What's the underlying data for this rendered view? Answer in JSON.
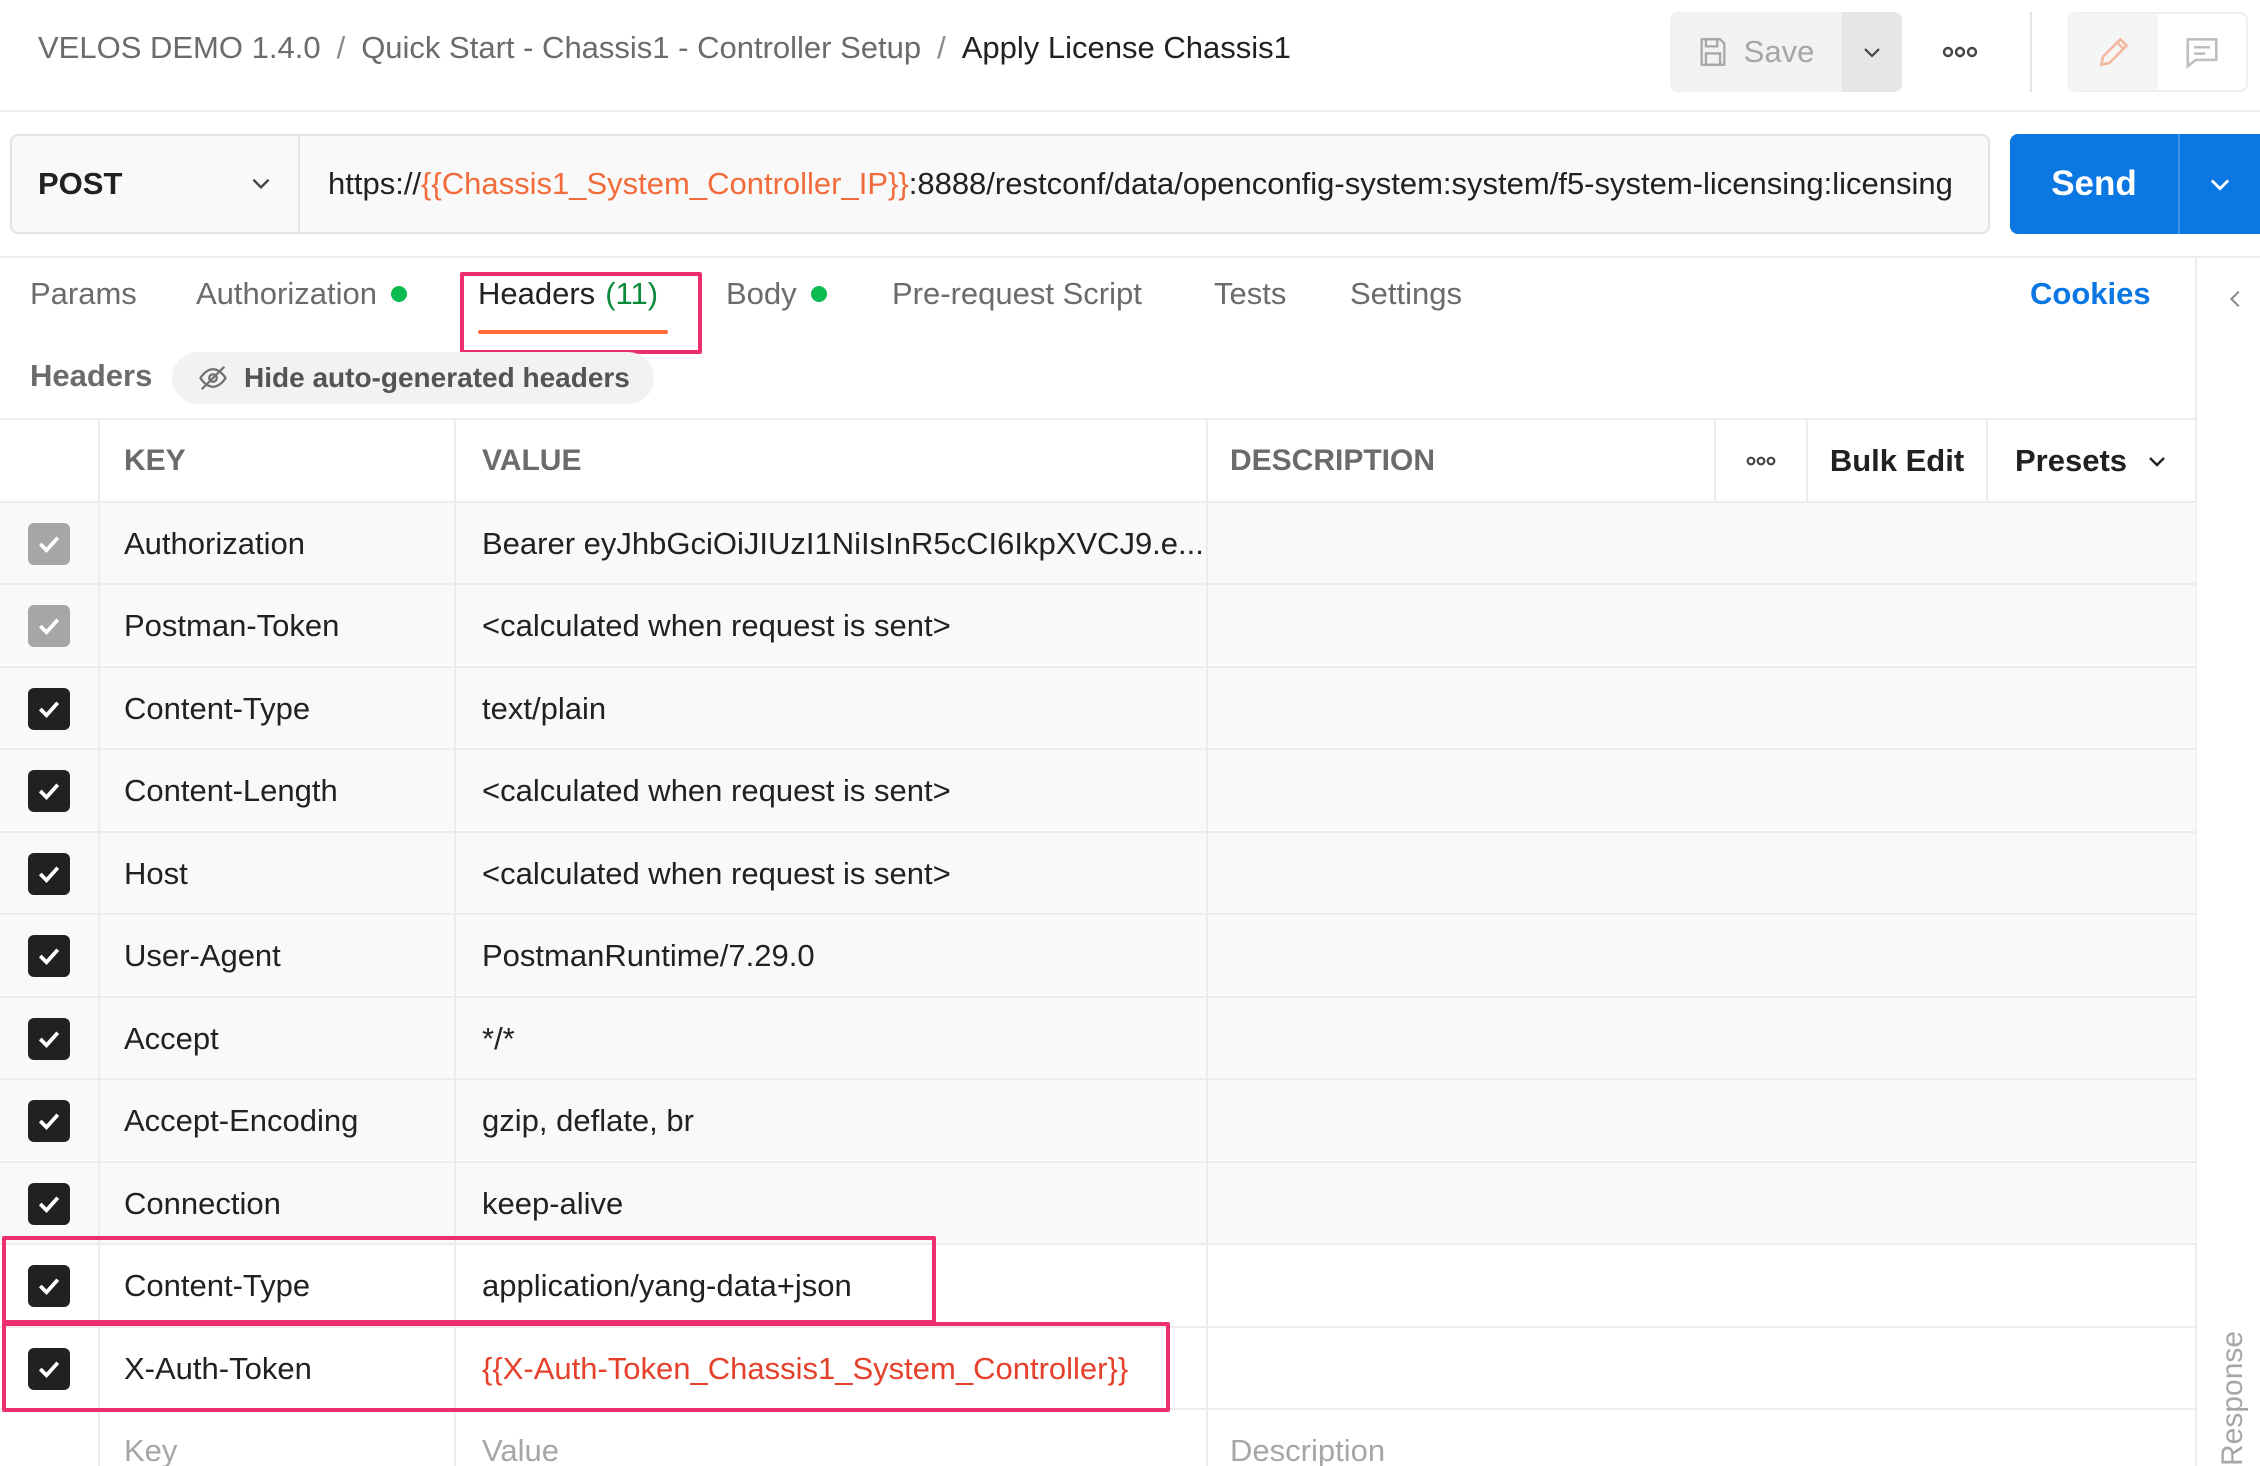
{
  "breadcrumb": {
    "collection": "VELOS DEMO 1.4.0",
    "folder": "Quick Start - Chassis1 - Controller Setup",
    "request": "Apply License Chassis1",
    "separator": "/"
  },
  "toolbar": {
    "save_label": "Save"
  },
  "request": {
    "method": "POST",
    "url_prefix": "https://",
    "url_variable": "{{Chassis1_System_Controller_IP}}",
    "url_suffix": ":8888/restconf/data/openconfig-system:system/f5-system-licensing:licensing"
  },
  "send_label": "Send",
  "tabs": {
    "params": "Params",
    "authorization": "Authorization",
    "headers": "Headers",
    "headers_count": "(11)",
    "body": "Body",
    "prerequest": "Pre-request Script",
    "tests": "Tests",
    "settings": "Settings",
    "cookies": "Cookies"
  },
  "headers_section": {
    "label": "Headers",
    "hide_auto_label": "Hide auto-generated headers"
  },
  "table": {
    "columns": {
      "key": "KEY",
      "value": "VALUE",
      "description": "DESCRIPTION"
    },
    "bulk_edit": "Bulk Edit",
    "presets": "Presets",
    "rows": [
      {
        "key": "Authorization",
        "value": "Bearer eyJhbGciOiJIUzI1NiIsInR5cCI6IkpXVCJ9.e...",
        "description": ""
      },
      {
        "key": "Postman-Token",
        "value": "<calculated when request is sent>",
        "description": ""
      },
      {
        "key": "Content-Type",
        "value": "text/plain",
        "description": ""
      },
      {
        "key": "Content-Length",
        "value": "<calculated when request is sent>",
        "description": ""
      },
      {
        "key": "Host",
        "value": "<calculated when request is sent>",
        "description": ""
      },
      {
        "key": "User-Agent",
        "value": "PostmanRuntime/7.29.0",
        "description": ""
      },
      {
        "key": "Accept",
        "value": "*/*",
        "description": ""
      },
      {
        "key": "Accept-Encoding",
        "value": "gzip, deflate, br",
        "description": ""
      },
      {
        "key": "Connection",
        "value": "keep-alive",
        "description": ""
      },
      {
        "key": "Content-Type",
        "value": "application/yang-data+json",
        "description": ""
      },
      {
        "key": "X-Auth-Token",
        "value": "{{X-Auth-Token_Chassis1_System_Controller}}",
        "description": ""
      }
    ],
    "placeholder": {
      "key": "Key",
      "value": "Value",
      "description": "Description"
    }
  },
  "response_label": "Response",
  "colors": {
    "accent": "#ff6c37",
    "send": "#0b77e3",
    "highlight": "#ee2f6d",
    "variable": "#f26b3a",
    "status_dot": "#0cbb52"
  }
}
